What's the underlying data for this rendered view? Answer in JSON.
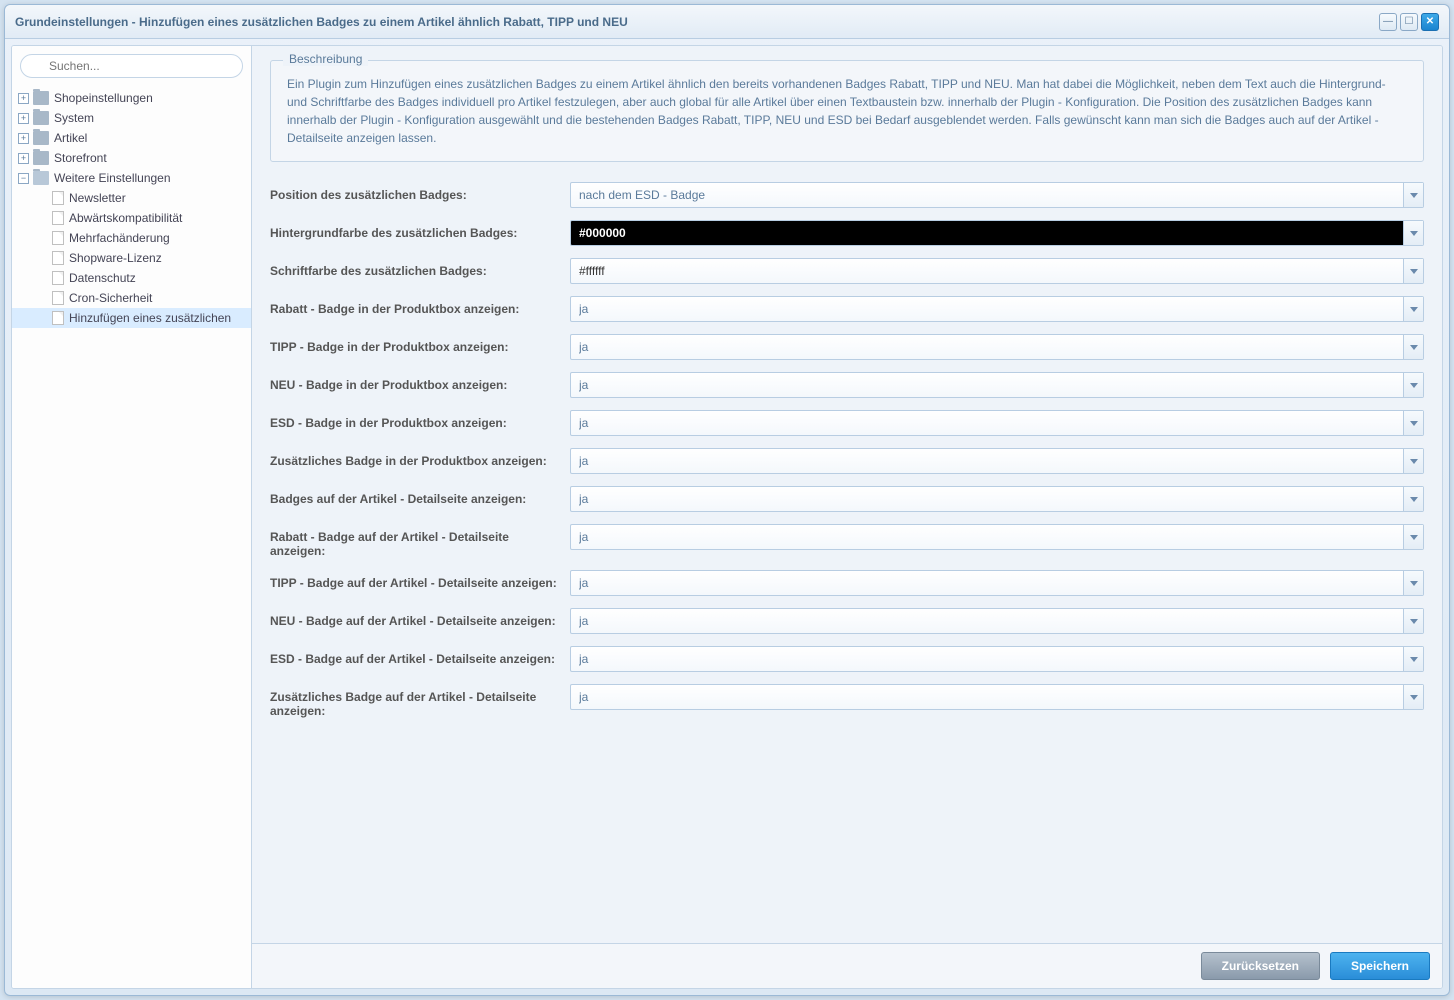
{
  "window": {
    "title": "Grundeinstellungen - Hinzufügen eines zusätzlichen Badges zu einem Artikel ähnlich Rabatt, TIPP und NEU"
  },
  "search": {
    "placeholder": "Suchen..."
  },
  "sidebar": {
    "top": [
      {
        "label": "Shopeinstellungen"
      },
      {
        "label": "System"
      },
      {
        "label": "Artikel"
      },
      {
        "label": "Storefront"
      },
      {
        "label": "Weitere Einstellungen"
      }
    ],
    "children": [
      {
        "label": "Newsletter"
      },
      {
        "label": "Abwärtskompatibilität"
      },
      {
        "label": "Mehrfachänderung"
      },
      {
        "label": "Shopware-Lizenz"
      },
      {
        "label": "Datenschutz"
      },
      {
        "label": "Cron-Sicherheit"
      },
      {
        "label": "Hinzufügen eines zusätzlichen"
      }
    ]
  },
  "fieldset": {
    "legend": "Beschreibung",
    "text": "Ein Plugin zum Hinzufügen eines zusätzlichen Badges zu einem Artikel ähnlich den bereits vorhandenen Badges Rabatt, TIPP und NEU. Man hat dabei die Möglichkeit, neben dem Text auch die Hintergrund- und Schriftfarbe des Badges individuell pro Artikel festzulegen, aber auch global für alle Artikel über einen Textbaustein bzw. innerhalb der Plugin - Konfiguration. Die Position des zusätzlichen Badges kann innerhalb der Plugin - Konfiguration ausgewählt und die bestehenden Badges Rabatt, TIPP, NEU und ESD bei Bedarf ausgeblendet werden. Falls gewünscht kann man sich die Badges auch auf der Artikel - Detailseite anzeigen lassen."
  },
  "fields": [
    {
      "label": "Position des zusätzlichen Badges:",
      "value": "nach dem ESD - Badge",
      "style": "normal"
    },
    {
      "label": "Hintergrundfarbe des zusätzlichen Badges:",
      "value": "#000000",
      "style": "black"
    },
    {
      "label": "Schriftfarbe des zusätzlichen Badges:",
      "value": "#ffffff",
      "style": "white"
    },
    {
      "label": "Rabatt - Badge in der Produktbox anzeigen:",
      "value": "ja",
      "style": "normal"
    },
    {
      "label": "TIPP - Badge in der Produktbox anzeigen:",
      "value": "ja",
      "style": "normal"
    },
    {
      "label": "NEU - Badge in der Produktbox anzeigen:",
      "value": "ja",
      "style": "normal"
    },
    {
      "label": "ESD - Badge in der Produktbox anzeigen:",
      "value": "ja",
      "style": "normal"
    },
    {
      "label": "Zusätzliches Badge in der Produktbox anzeigen:",
      "value": "ja",
      "style": "normal"
    },
    {
      "label": "Badges auf der Artikel - Detailseite anzeigen:",
      "value": "ja",
      "style": "normal"
    },
    {
      "label": "Rabatt - Badge auf der Artikel - Detailseite anzeigen:",
      "value": "ja",
      "style": "normal"
    },
    {
      "label": "TIPP - Badge auf der Artikel - Detailseite anzeigen:",
      "value": "ja",
      "style": "normal"
    },
    {
      "label": "NEU - Badge auf der Artikel - Detailseite anzeigen:",
      "value": "ja",
      "style": "normal"
    },
    {
      "label": "ESD - Badge auf der Artikel - Detailseite anzeigen:",
      "value": "ja",
      "style": "normal"
    },
    {
      "label": "Zusätzliches Badge auf der Artikel - Detailseite anzeigen:",
      "value": "ja",
      "style": "normal"
    }
  ],
  "footer": {
    "reset": "Zurücksetzen",
    "save": "Speichern"
  }
}
